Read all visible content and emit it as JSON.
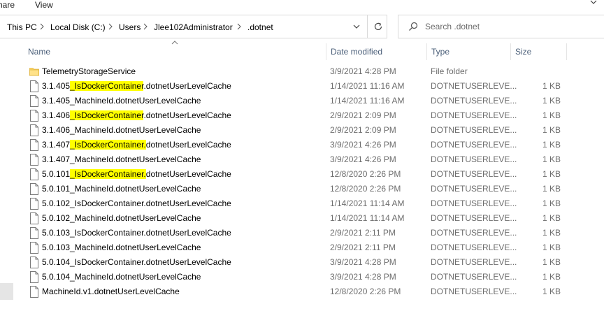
{
  "ribbon": {
    "tabs": [
      "hare",
      "View"
    ]
  },
  "address": {
    "crumbs": [
      "This PC",
      "Local Disk (C:)",
      "Users",
      "Jlee102Administrator",
      ".dotnet"
    ]
  },
  "search": {
    "placeholder": "Search .dotnet"
  },
  "columns": {
    "name": "Name",
    "date": "Date modified",
    "type": "Type",
    "size": "Size"
  },
  "colors": {
    "highlight": "#ffff00",
    "header_text": "#4c607a",
    "folder": "#ffd86b"
  },
  "files": [
    {
      "icon": "folder-icon",
      "pre": "TelemetryStorageService",
      "hl": "",
      "post": "",
      "date": "3/9/2021 4:28 PM",
      "type": "File folder",
      "size": ""
    },
    {
      "icon": "file-icon",
      "pre": "3.1.405",
      "hl": "_IsDockerContainer",
      "post": ".dotnetUserLevelCache",
      "date": "1/14/2021 11:16 AM",
      "type": "DOTNETUSERLEVE...",
      "size": "1 KB"
    },
    {
      "icon": "file-icon",
      "pre": "3.1.405_MachineId.dotnetUserLevelCache",
      "hl": "",
      "post": "",
      "date": "1/14/2021 11:16 AM",
      "type": "DOTNETUSERLEVE...",
      "size": "1 KB"
    },
    {
      "icon": "file-icon",
      "pre": "3.1.406",
      "hl": "_IsDockerContainer",
      "post": ".dotnetUserLevelCache",
      "date": "2/9/2021 2:09 PM",
      "type": "DOTNETUSERLEVE...",
      "size": "1 KB"
    },
    {
      "icon": "file-icon",
      "pre": "3.1.406_MachineId.dotnetUserLevelCache",
      "hl": "",
      "post": "",
      "date": "2/9/2021 2:09 PM",
      "type": "DOTNETUSERLEVE...",
      "size": "1 KB"
    },
    {
      "icon": "file-icon",
      "pre": "3.1.407",
      "hl": "_IsDockerContainer.",
      "post": "dotnetUserLevelCache",
      "date": "3/9/2021 4:26 PM",
      "type": "DOTNETUSERLEVE...",
      "size": "1 KB"
    },
    {
      "icon": "file-icon",
      "pre": "3.1.407_MachineId.dotnetUserLevelCache",
      "hl": "",
      "post": "",
      "date": "3/9/2021 4:26 PM",
      "type": "DOTNETUSERLEVE...",
      "size": "1 KB"
    },
    {
      "icon": "file-icon",
      "pre": "5.0.101",
      "hl": "_IsDockerContainer.",
      "post": "dotnetUserLevelCache",
      "date": "12/8/2020 2:26 PM",
      "type": "DOTNETUSERLEVE...",
      "size": "1 KB"
    },
    {
      "icon": "file-icon",
      "pre": "5.0.101_MachineId.dotnetUserLevelCache",
      "hl": "",
      "post": "",
      "date": "12/8/2020 2:26 PM",
      "type": "DOTNETUSERLEVE...",
      "size": "1 KB"
    },
    {
      "icon": "file-icon",
      "pre": "5.0.102_IsDockerContainer.dotnetUserLevelCache",
      "hl": "",
      "post": "",
      "date": "1/14/2021 11:14 AM",
      "type": "DOTNETUSERLEVE...",
      "size": "1 KB"
    },
    {
      "icon": "file-icon",
      "pre": "5.0.102_MachineId.dotnetUserLevelCache",
      "hl": "",
      "post": "",
      "date": "1/14/2021 11:14 AM",
      "type": "DOTNETUSERLEVE...",
      "size": "1 KB"
    },
    {
      "icon": "file-icon",
      "pre": "5.0.103_IsDockerContainer.dotnetUserLevelCache",
      "hl": "",
      "post": "",
      "date": "2/9/2021 2:11 PM",
      "type": "DOTNETUSERLEVE...",
      "size": "1 KB"
    },
    {
      "icon": "file-icon",
      "pre": "5.0.103_MachineId.dotnetUserLevelCache",
      "hl": "",
      "post": "",
      "date": "2/9/2021 2:11 PM",
      "type": "DOTNETUSERLEVE...",
      "size": "1 KB"
    },
    {
      "icon": "file-icon",
      "pre": "5.0.104_IsDockerContainer.dotnetUserLevelCache",
      "hl": "",
      "post": "",
      "date": "3/9/2021 4:28 PM",
      "type": "DOTNETUSERLEVE...",
      "size": "1 KB"
    },
    {
      "icon": "file-icon",
      "pre": "5.0.104_MachineId.dotnetUserLevelCache",
      "hl": "",
      "post": "",
      "date": "3/9/2021 4:28 PM",
      "type": "DOTNETUSERLEVE...",
      "size": "1 KB"
    },
    {
      "icon": "file-icon",
      "pre": "MachineId.v1.dotnetUserLevelCache",
      "hl": "",
      "post": "",
      "date": "12/8/2020 2:26 PM",
      "type": "DOTNETUSERLEVE...",
      "size": "1 KB"
    }
  ]
}
